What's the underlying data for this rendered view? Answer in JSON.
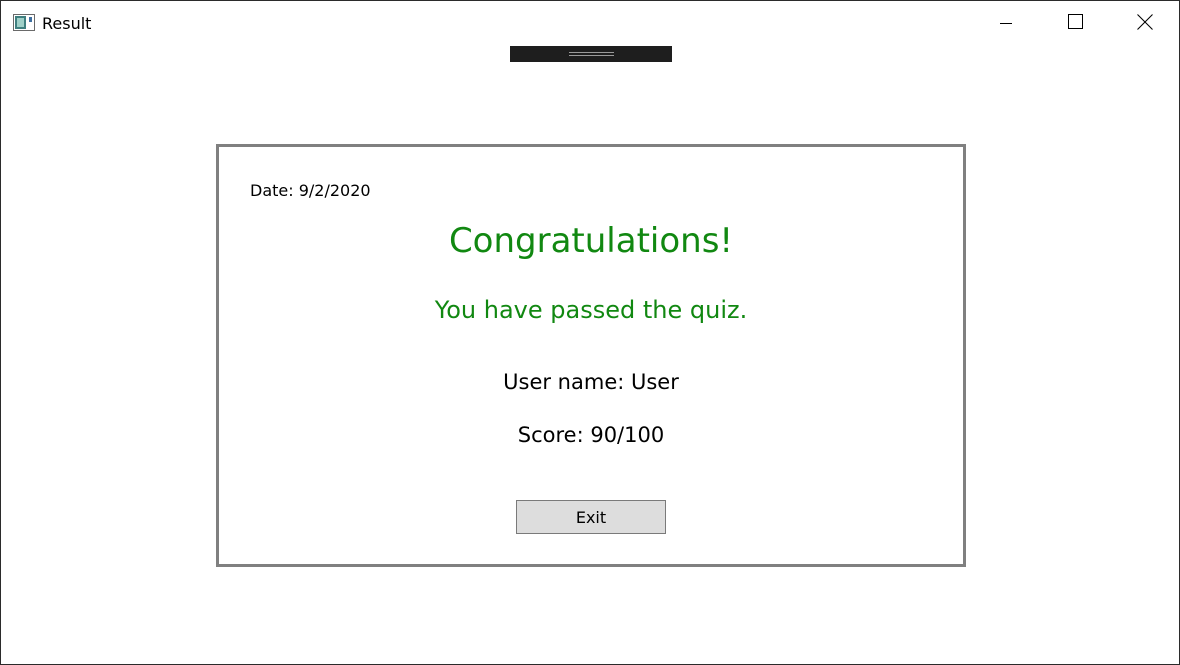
{
  "window": {
    "title": "Result",
    "icons": {
      "app": "app-window-icon",
      "minimize": "minimize-icon",
      "maximize": "maximize-icon",
      "close": "close-icon"
    }
  },
  "result": {
    "date": "Date: 9/2/2020",
    "heading": "Congratulations!",
    "message": "You have passed the quiz.",
    "user_name": "User name: User",
    "score": "Score: 90/100",
    "exit_label": "Exit"
  },
  "colors": {
    "success_text": "#118811",
    "card_border": "#808080",
    "button_background": "#dddddd",
    "debug_toolbar": "#1e1e1e"
  }
}
